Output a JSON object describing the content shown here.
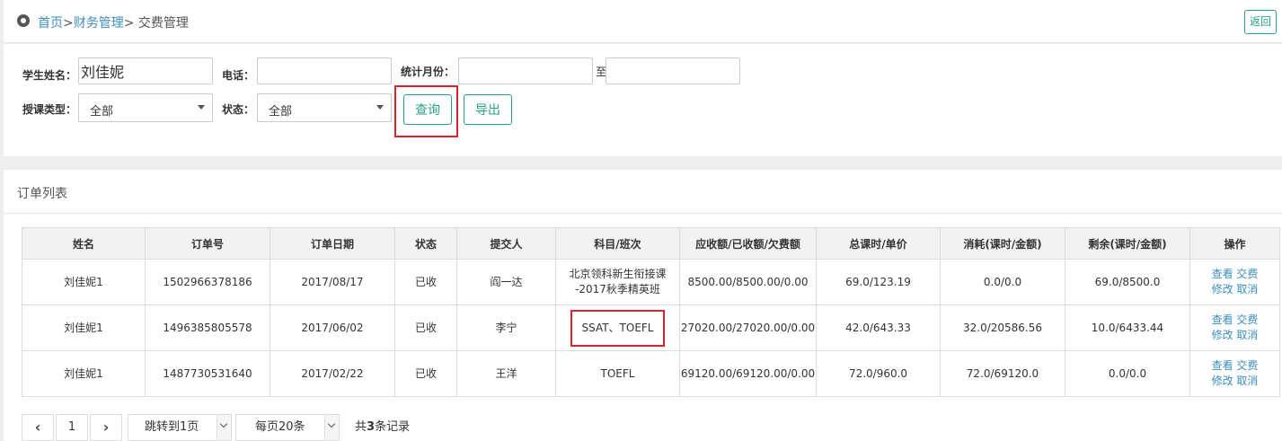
{
  "breadcrumb": {
    "home": "首页",
    "sep1": ">",
    "finance": "财务管理",
    "sep2": ">",
    "current": " 交费管理"
  },
  "header": {
    "back_label": "返回"
  },
  "filters": {
    "student_name_label": "学生姓名：",
    "student_name_value": "刘佳妮",
    "phone_label": "电话：",
    "phone_value": "",
    "month_label": "统计月份：",
    "month_from": "",
    "to_label": "至",
    "month_to": "",
    "type_label": "授课类型：",
    "type_value": "全部",
    "status_label": "状态：",
    "status_value": "全部",
    "query_label": "查询",
    "export_label": "导出"
  },
  "list": {
    "title": "订单列表",
    "columns": [
      "姓名",
      "订单号",
      "订单日期",
      "状态",
      "提交人",
      "科目/班次",
      "应收额/已收额/欠费额",
      "总课时/单价",
      "消耗(课时/金额)",
      "剩余(课时/金额)",
      "操作"
    ],
    "rows": [
      {
        "name": "刘佳妮1",
        "order_no": "1502966378186",
        "date": "2017/08/17",
        "status": "已收",
        "submitter": "阎一达",
        "subject_line1": "北京领科新生衔接课",
        "subject_line2": "-2017秋季精英班",
        "amounts": "8500.00/8500.00/0.00",
        "hours_price": "69.0/123.19",
        "consumed": "0.0/0.0",
        "remaining": "69.0/8500.0"
      },
      {
        "name": "刘佳妮1",
        "order_no": "1496385805578",
        "date": "2017/06/02",
        "status": "已收",
        "submitter": "李宁",
        "subject_line1": "SSAT、TOEFL",
        "subject_line2": "",
        "amounts": "27020.00/27020.00/0.00",
        "hours_price": "42.0/643.33",
        "consumed": "32.0/20586.56",
        "remaining": "10.0/6433.44"
      },
      {
        "name": "刘佳妮1",
        "order_no": "1487730531640",
        "date": "2017/02/22",
        "status": "已收",
        "submitter": "王洋",
        "subject_line1": "TOEFL",
        "subject_line2": "",
        "amounts": "69120.00/69120.00/0.00",
        "hours_price": "72.0/960.0",
        "consumed": "72.0/69120.0",
        "remaining": "0.0/0.0"
      }
    ],
    "ops": {
      "view": "查看",
      "pay": "交费",
      "edit": "修改",
      "cancel": "取消"
    }
  },
  "pagination": {
    "current_page": "1",
    "jump_label": "跳转到1页",
    "per_page_label": "每页20条",
    "total_prefix": "共",
    "total_count": "3",
    "total_suffix": "条记录"
  },
  "colors": {
    "accent": "#2aa088",
    "link": "#3c8dbc",
    "highlight": "#d9232b"
  }
}
